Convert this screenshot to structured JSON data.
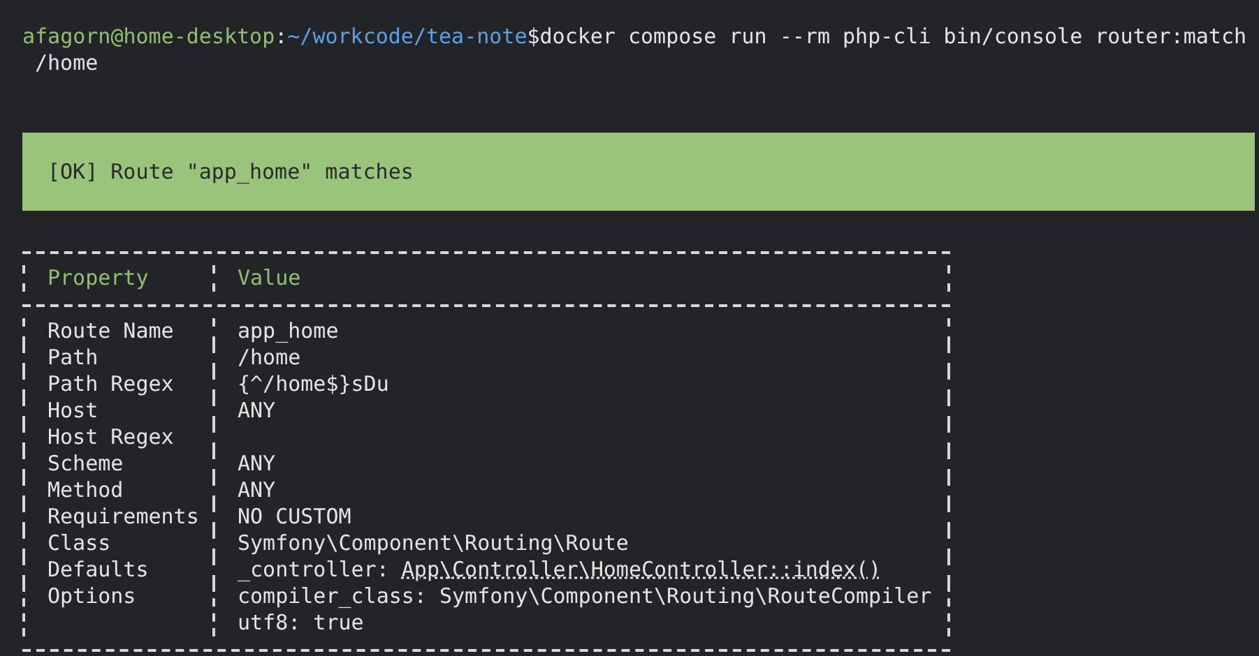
{
  "prompt": {
    "user_host": "afagorn@home-desktop",
    "separator": ":",
    "path": "~/workcode/tea-note",
    "symbol": "$",
    "command": "docker compose run --rm php-cli bin/console router:match",
    "continuation": "/home"
  },
  "banner": {
    "kind": "success",
    "text": "[OK] Route \"app_home\" matches"
  },
  "table": {
    "columns": [
      "Property",
      "Value"
    ],
    "rows": [
      {
        "property": "Route Name",
        "lines": [
          {
            "text": "app_home"
          }
        ]
      },
      {
        "property": "Path",
        "lines": [
          {
            "text": "/home"
          }
        ]
      },
      {
        "property": "Path Regex",
        "lines": [
          {
            "text": "{^/home$}sDu"
          }
        ]
      },
      {
        "property": "Host",
        "lines": [
          {
            "text": "ANY"
          }
        ]
      },
      {
        "property": "Host Regex",
        "lines": []
      },
      {
        "property": "Scheme",
        "lines": [
          {
            "text": "ANY"
          }
        ]
      },
      {
        "property": "Method",
        "lines": [
          {
            "text": "ANY"
          }
        ]
      },
      {
        "property": "Requirements",
        "lines": [
          {
            "text": "NO CUSTOM"
          }
        ]
      },
      {
        "property": "Class",
        "lines": [
          {
            "text": "Symfony\\Component\\Routing\\Route"
          }
        ]
      },
      {
        "property": "Defaults",
        "lines": [
          {
            "text": "_controller: ",
            "link": "App\\Controller\\HomeController::index()"
          }
        ]
      },
      {
        "property": "Options",
        "lines": [
          {
            "text": "compiler_class: Symfony\\Component\\Routing\\RouteCompiler"
          },
          {
            "text": "utf8: true"
          }
        ]
      }
    ]
  }
}
